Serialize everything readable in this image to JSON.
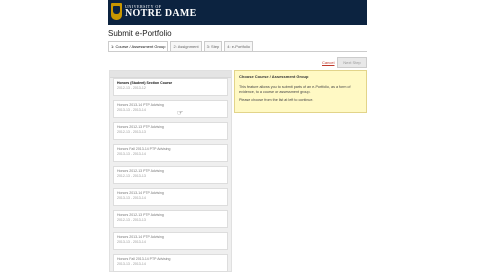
{
  "header": {
    "logo_top": "UNIVERSITY OF",
    "logo_main": "NOTRE DAME"
  },
  "page_title": "Submit e-Portfolio",
  "tabs": [
    {
      "label": "1: Course / Assessment Group",
      "active": true
    },
    {
      "label": "2: Assignment",
      "active": false
    },
    {
      "label": "3: Step",
      "active": false
    },
    {
      "label": "4: e-Portfolio",
      "active": false
    }
  ],
  "actions": {
    "cancel_label": "Cancel",
    "next_label": "Next Step"
  },
  "list": {
    "items": [
      {
        "title": "Honors (Student) Section Course",
        "date": "2012-13 - 2013-12"
      },
      {
        "title": "Honors 2013-14 PTP Advising",
        "date": "2013-13 - 2013-14"
      },
      {
        "title": "Honors 2012-13 PTP Advising",
        "date": "2012-13 - 2013-13"
      },
      {
        "title": "Honors Fall 2013-14 PTP Advising",
        "date": "2013-13 - 2013-14"
      },
      {
        "title": "Honors 2012-13 PTP Advising",
        "date": "2012-13 - 2013-13"
      },
      {
        "title": "Honors 2013-14 PTP Advising",
        "date": "2013-13 - 2013-14"
      },
      {
        "title": "Honors 2012-13 PTP Advising",
        "date": "2012-13 - 2013-13"
      },
      {
        "title": "Honors 2013-14 PTP Advising",
        "date": "2013-13 - 2013-14"
      },
      {
        "title": "Honors Fall 2013-14 PTP Advising",
        "date": "2013-13 - 2013-14"
      }
    ]
  },
  "info": {
    "title": "Choose Course / Assessment Group",
    "text1": "This feature allows you to submit parts of an e-Portfolio, as a form of evidence, to a course or assessment group.",
    "text2": "Please choose from the list at left to continue."
  }
}
